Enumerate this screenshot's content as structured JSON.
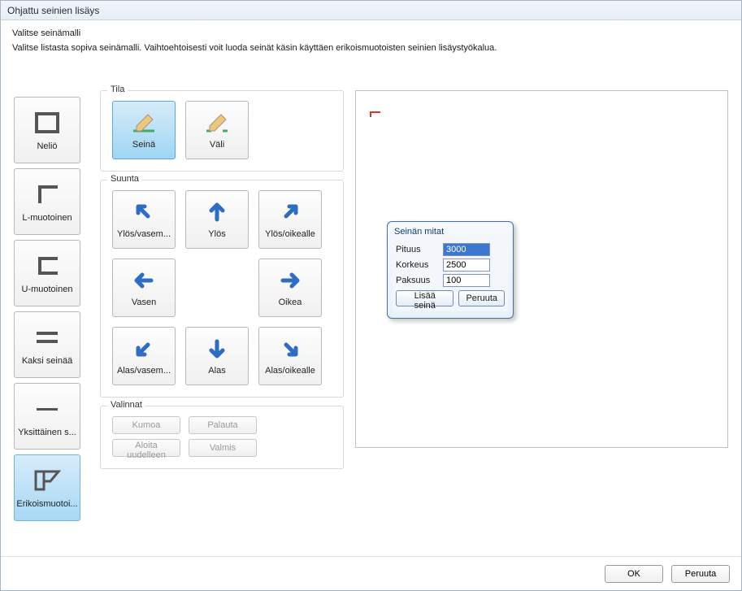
{
  "window": {
    "title": "Ohjattu seinien lisäys"
  },
  "header": {
    "title": "Valitse seinämalli",
    "subtitle": "Valitse listasta sopiva seinämalli. Vaihtoehtoisesti voit luoda seinät käsin käyttäen erikoismuotoisten seinien lisäystyökalua."
  },
  "shapes": {
    "items": [
      {
        "label": "Neliö"
      },
      {
        "label": "L-muotoinen"
      },
      {
        "label": "U-muotoinen"
      },
      {
        "label": "Kaksi seinää"
      },
      {
        "label": "Yksittäinen s..."
      },
      {
        "label": "Erikoismuotoi..."
      }
    ]
  },
  "tila": {
    "title": "Tila",
    "seina": "Seinä",
    "vali": "Väli"
  },
  "suunta": {
    "title": "Suunta",
    "ul": "Ylös/vasem...",
    "up": "Ylös",
    "ur": "Ylös/oikealle",
    "left": "Vasen",
    "right": "Oikea",
    "dl": "Alas/vasem...",
    "down": "Alas",
    "dr": "Alas/oikealle"
  },
  "valinnat": {
    "title": "Valinnat",
    "kumoa": "Kumoa",
    "palauta": "Palauta",
    "aloita": "Aloita uudelleen",
    "valmis": "Valmis"
  },
  "dims": {
    "title": "Seinän mitat",
    "pituus_label": "Pituus",
    "pituus_value": "3000",
    "korkeus_label": "Korkeus",
    "korkeus_value": "2500",
    "paksuus_label": "Paksuus",
    "paksuus_value": "100",
    "add": "Lisää seinä",
    "cancel": "Peruuta"
  },
  "footer": {
    "ok": "OK",
    "cancel": "Peruuta"
  }
}
